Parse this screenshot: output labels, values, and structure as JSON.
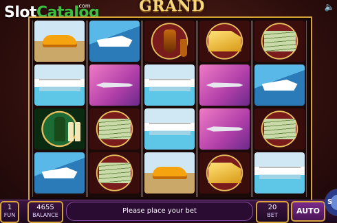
{
  "header": {
    "logo_main": "Slot",
    "logo_accent": "Catalog",
    "logo_suffix": ".com",
    "game_title": "GRAND RICHES",
    "sound_icon": "speaker-icon"
  },
  "reels": [
    [
      "car",
      "pool",
      "champagne",
      "yacht"
    ],
    [
      "yacht",
      "jet",
      "money",
      "money"
    ],
    [
      "cognac",
      "pool",
      "pool",
      "car"
    ],
    [
      "gold",
      "jet",
      "jet",
      "gold"
    ],
    [
      "money",
      "yacht",
      "money",
      "pool"
    ]
  ],
  "footer": {
    "lines_value": "1",
    "lines_label": "FUN",
    "balance_value": "4655",
    "balance_label": "BALANCE",
    "message": "Please place your bet",
    "bet_value": "20",
    "bet_label": "BET",
    "auto_label": "AUTO",
    "spin_label": "S"
  },
  "colors": {
    "frame_gold": "#d8a43a",
    "bar_purple": "#3a1440",
    "logo_green": "#3fbd3f"
  }
}
